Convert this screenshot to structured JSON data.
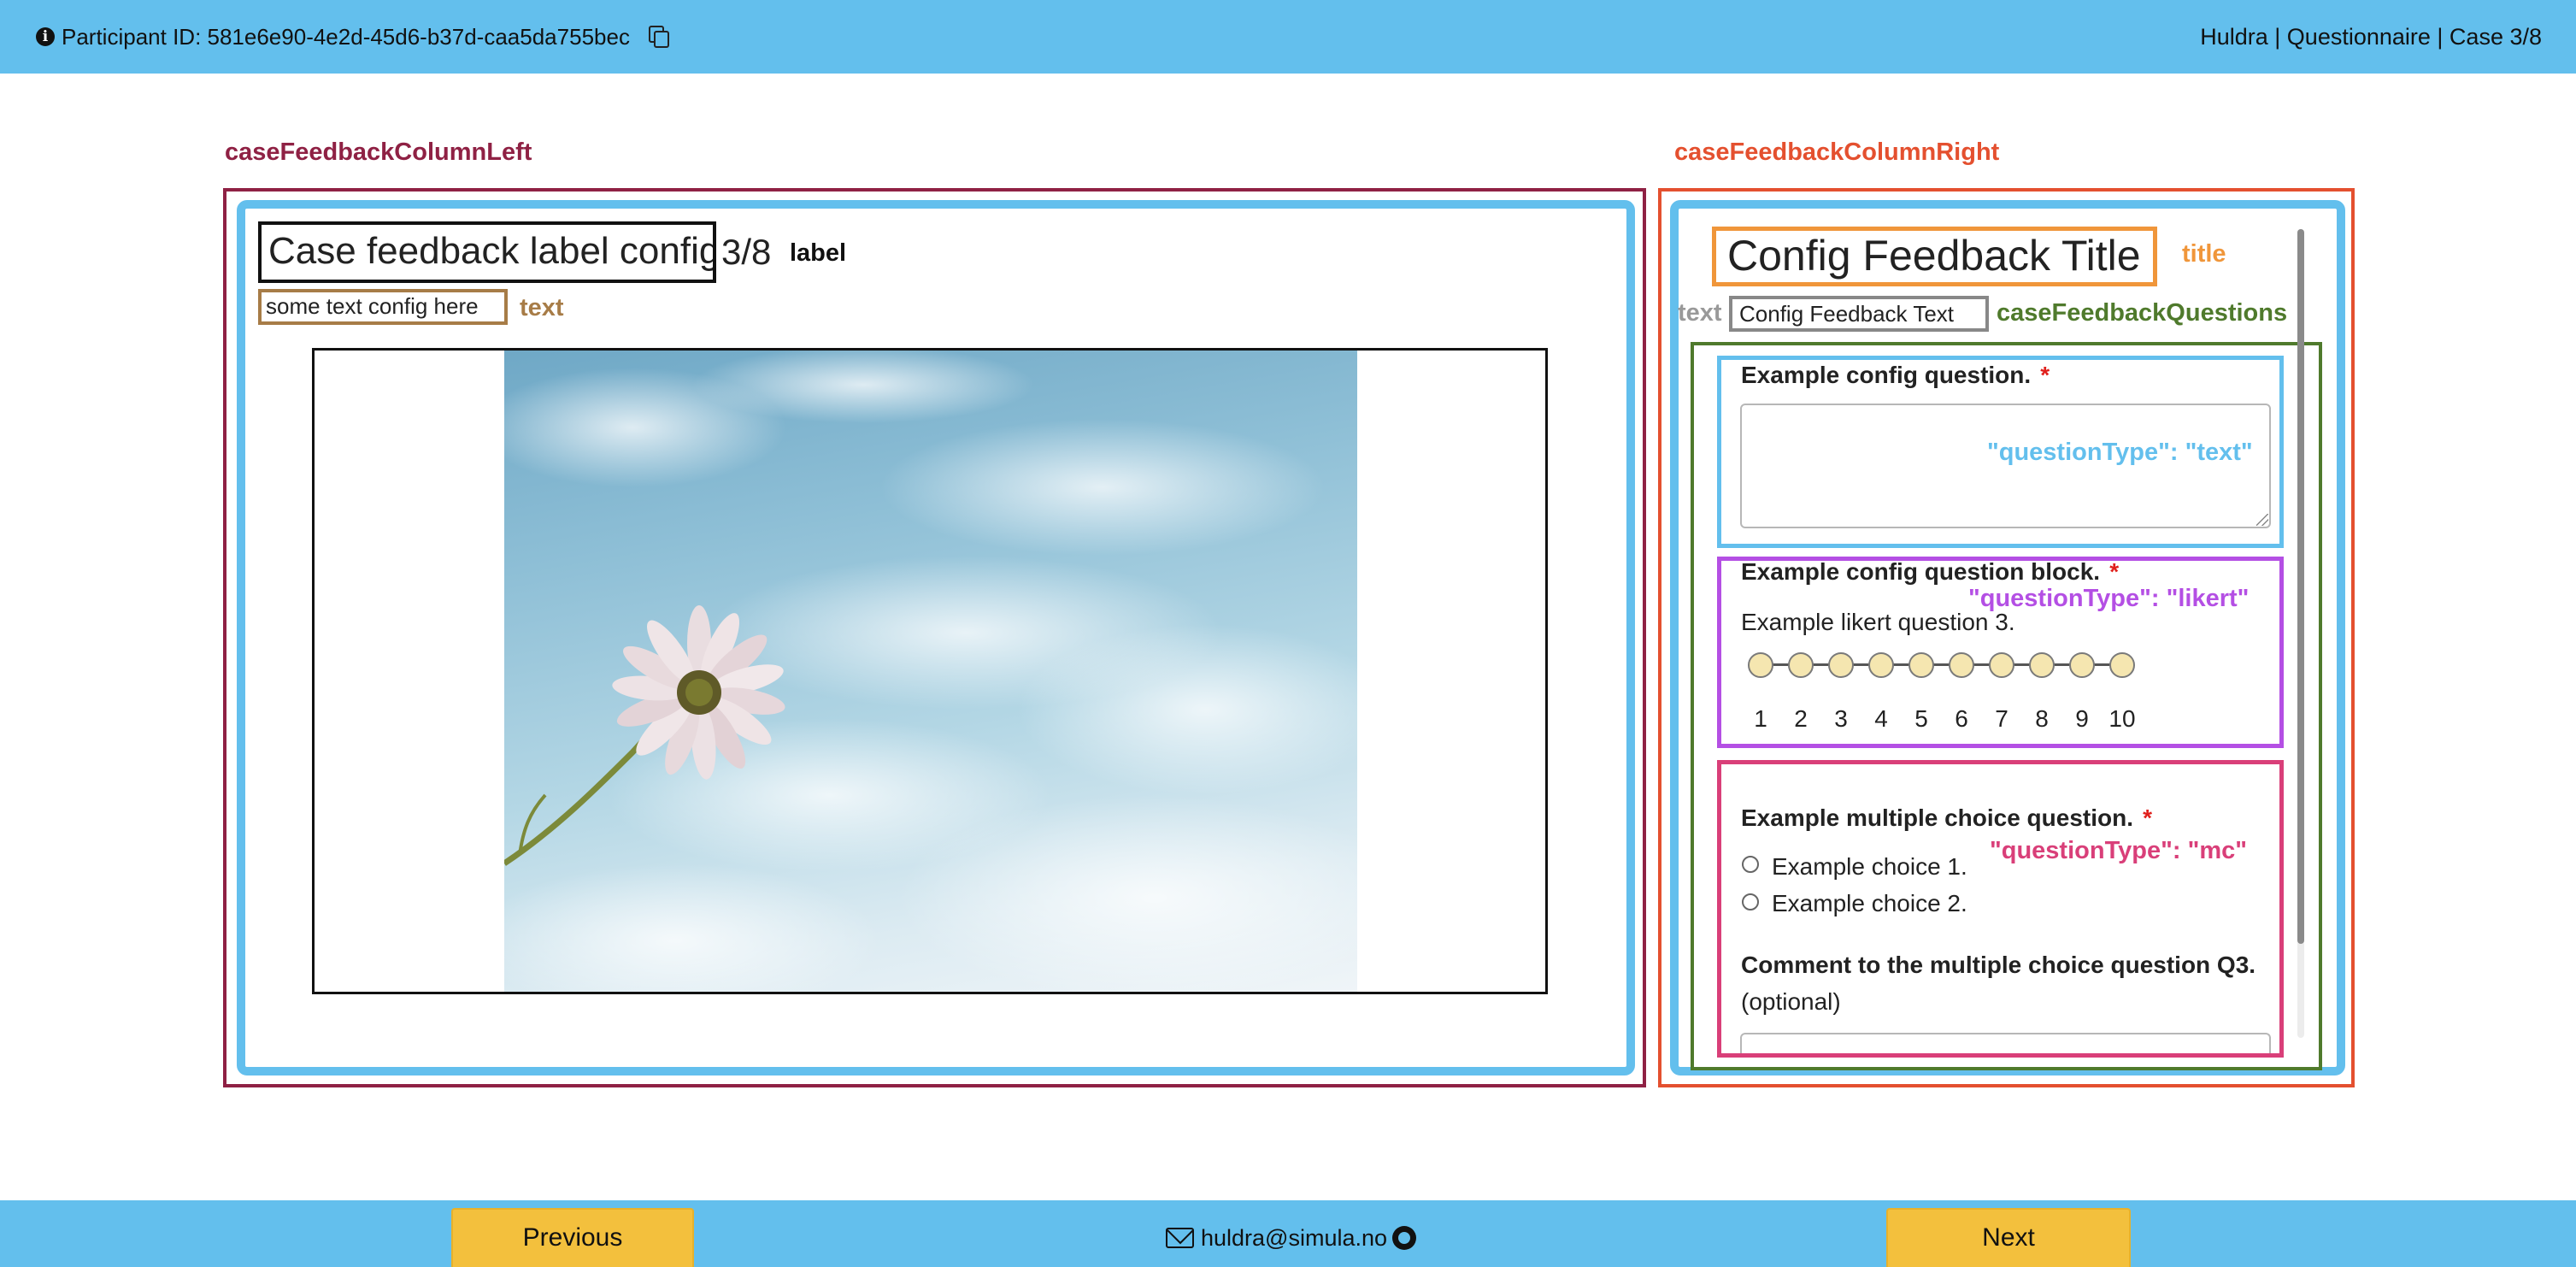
{
  "header": {
    "participant": "Participant ID: 581e6e90-4e2d-45d6-b37d-caa5da755bec",
    "breadcrumb": "Huldra | Questionnaire | Case 3/8"
  },
  "annotations": {
    "left_column": "caseFeedbackColumnLeft",
    "right_column": "caseFeedbackColumnRight",
    "label_tag": "label",
    "text_tag": "text",
    "title_tag": "title",
    "right_text_tag": "text",
    "questions_tag": "caseFeedbackQuestions",
    "qtype_text": "\"questionType\": \"text\"",
    "qtype_likert": "\"questionType\": \"likert\"",
    "qtype_mc": "\"questionType\": \"mc\""
  },
  "annotation_colors": {
    "left_column": "#8f2144",
    "right_column": "#e4502f",
    "text_tag": "#a77c47",
    "title_tag": "#f0963a",
    "right_text_tag": "#999999",
    "questions_tag": "#4f7a2c",
    "qtype_text": "#63bfed",
    "qtype_likert": "#b44fe4",
    "qtype_mc": "#d93f79"
  },
  "case": {
    "label": "Case feedback label config",
    "count": "3/8",
    "text": "some text config here"
  },
  "feedback": {
    "title": "Config Feedback Title",
    "text": "Config Feedback Text"
  },
  "questions": {
    "q1": {
      "label": "Example config question.",
      "required_mark": "*"
    },
    "q2": {
      "label": "Example config question block.",
      "required_mark": "*",
      "sub_label": "Example likert question 3.",
      "scale": [
        "1",
        "2",
        "3",
        "4",
        "5",
        "6",
        "7",
        "8",
        "9",
        "10"
      ]
    },
    "q3": {
      "label": "Example multiple choice question.",
      "required_mark": "*",
      "choices": [
        "Example choice 1.",
        "Example choice 2."
      ],
      "comment_label": "Comment to the multiple choice question Q3.",
      "comment_optional": "(optional)"
    }
  },
  "footer": {
    "previous": "Previous",
    "next": "Next",
    "email": "huldra@simula.no"
  },
  "colors": {
    "bar": "#63bfed",
    "button": "#f3c03d"
  }
}
